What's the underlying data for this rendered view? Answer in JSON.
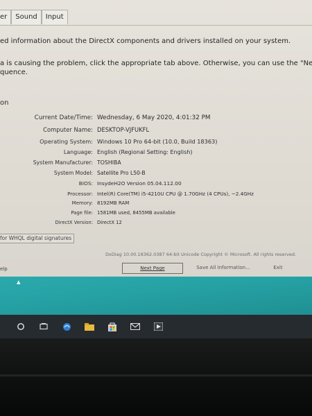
{
  "tabs": [
    "er",
    "Sound",
    "Input"
  ],
  "intro_text": "ed information about the DirectX components and drivers installed on your system.",
  "hint_line1": "a is causing the problem, click the appropriate tab above.  Otherwise, you can use the \"Next Page\" button be",
  "hint_line2": "quence.",
  "group_label": "on",
  "system_info": [
    {
      "label": "Current Date/Time:",
      "value": "Wednesday, 6 May 2020, 4:01:32 PM"
    },
    {
      "label": "Computer Name:",
      "value": "DESKTOP-VJFUKFL"
    },
    {
      "label": "Operating System:",
      "value": "Windows 10 Pro 64-bit (10.0, Build 18363)"
    },
    {
      "label": "Language:",
      "value": "English (Regional Setting: English)"
    },
    {
      "label": "System Manufacturer:",
      "value": "TOSHIBA"
    },
    {
      "label": "System Model:",
      "value": "Satellite Pro L50-B"
    },
    {
      "label": "BIOS:",
      "value": "InsydeH2O Version 05.04.112.00"
    },
    {
      "label": "Processor:",
      "value": "Intel(R) Core(TM) i5-4210U CPU @ 1.70GHz (4 CPUs), ~2.4GHz"
    },
    {
      "label": "Memory:",
      "value": "8192MB RAM"
    },
    {
      "label": "Page file:",
      "value": "1581MB used, 8455MB available"
    },
    {
      "label": "DirectX Version:",
      "value": "DirectX 12"
    }
  ],
  "whql_checkbox_label": "for WHQL digital signatures",
  "footer_text": "DxDiag 10.00.18362.0387 64-bit Unicode  Copyright © Microsoft. All rights reserved.",
  "buttons": {
    "help": "elp",
    "next_page": "Next Page",
    "save_all": "Save All Information...",
    "exit": "Exit"
  },
  "taskbar_icons": [
    "search-circle-icon",
    "task-view-icon",
    "edge-icon",
    "file-explorer-icon",
    "store-icon",
    "mail-icon",
    "media-icon"
  ],
  "colors": {
    "desktop": "#26a2a4",
    "taskbar": "#252b2e",
    "dialog": "#e3e0d9"
  }
}
